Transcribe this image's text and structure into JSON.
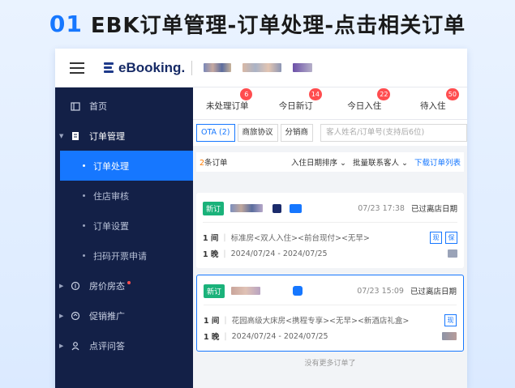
{
  "heading": {
    "number": "01",
    "title": "EBK订单管理-订单处理-点击相关订单"
  },
  "brand": {
    "name": "eBooking.",
    "accent": "#1677ff",
    "sidebar_bg": "#132047"
  },
  "topbar": {
    "menu_icon": "hamburger-icon"
  },
  "sidebar": {
    "items": [
      {
        "label": "首页",
        "icon": "home-icon"
      },
      {
        "label": "订单管理",
        "icon": "document-icon"
      },
      {
        "label": "订单处理"
      },
      {
        "label": "住店审核"
      },
      {
        "label": "订单设置"
      },
      {
        "label": "扫码开票申请"
      },
      {
        "label": "房价房态",
        "icon": "room-price-icon"
      },
      {
        "label": "促销推广",
        "icon": "promotion-icon"
      },
      {
        "label": "点评问答",
        "icon": "review-icon"
      }
    ]
  },
  "tabs": [
    {
      "label": "未处理订单",
      "badge": "6"
    },
    {
      "label": "今日新订",
      "badge": "14"
    },
    {
      "label": "今日入住",
      "badge": "22"
    },
    {
      "label": "待入住",
      "badge": "50"
    }
  ],
  "filters": {
    "ota": "OTA (2)",
    "agreement": "商旅协议",
    "distributor": "分销商",
    "search_placeholder": "客人姓名/订单号(支持后6位)"
  },
  "toolbar": {
    "count_num": "2",
    "count_label": "条订单",
    "sort": "入住日期排序",
    "bulk": "批量联系客人",
    "download": "下载订单列表"
  },
  "orders": [
    {
      "tag": "新订",
      "time": "07/23 17:38",
      "deadline": "已过离店日期",
      "rooms": "1 间",
      "room_desc": "标准房<双人入住><前台现付><无早>",
      "nights": "1 晚",
      "dates": "2024/07/24 - 2024/07/25",
      "mini_buttons": [
        "现",
        "保"
      ]
    },
    {
      "tag": "新订",
      "time": "07/23 15:09",
      "deadline": "已过离店日期",
      "rooms": "1 间",
      "room_desc": "花园高级大床房<携程专享><无早><新酒店礼盒>",
      "nights": "1 晚",
      "dates": "2024/07/24 - 2024/07/25",
      "mini_buttons": [
        "现"
      ]
    }
  ],
  "footer": "没有更多订单了"
}
